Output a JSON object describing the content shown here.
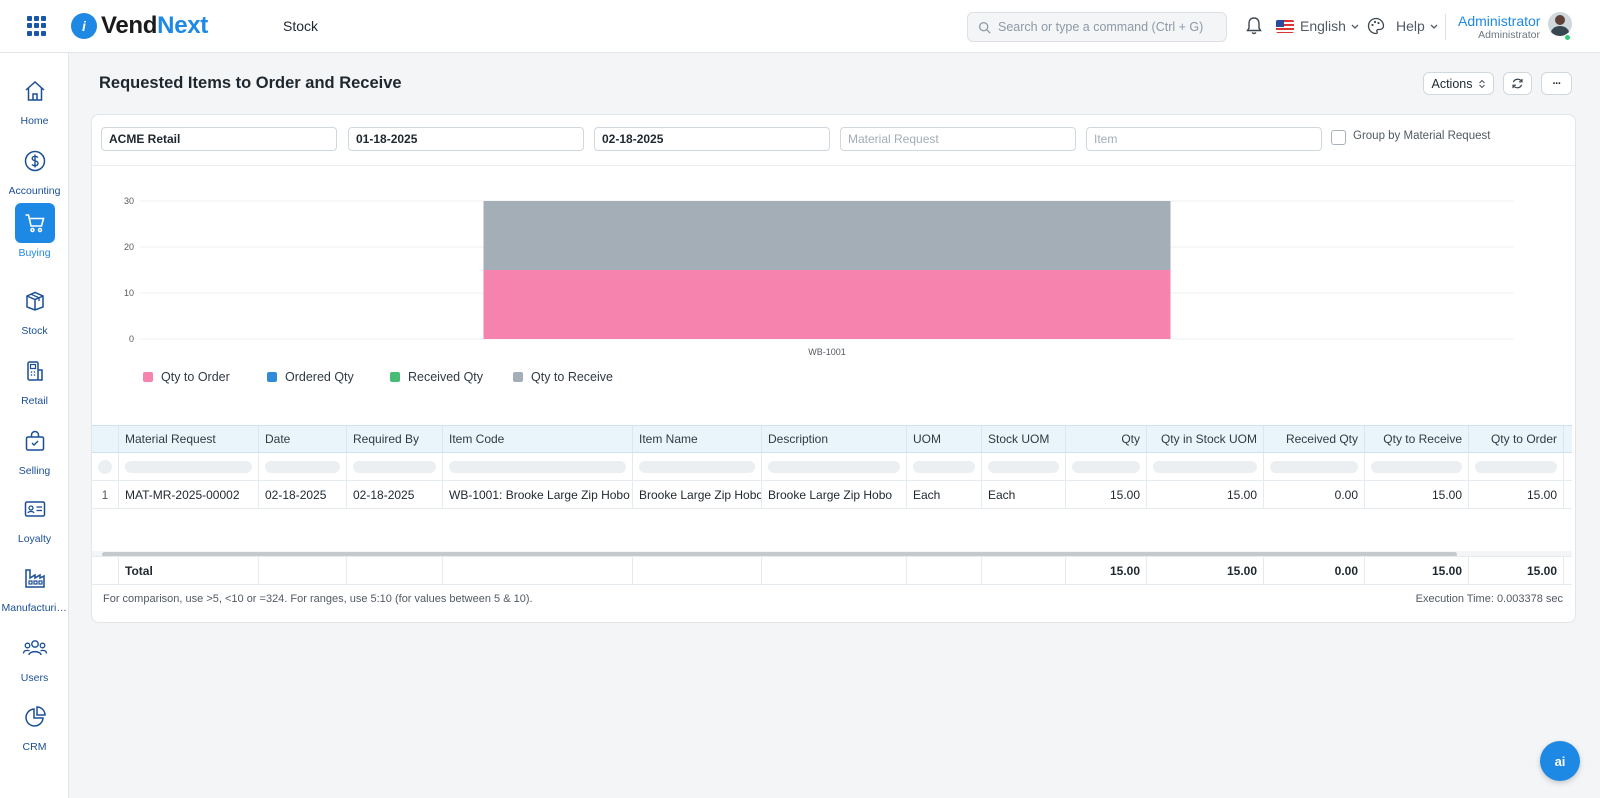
{
  "header": {
    "brand_i": "i",
    "brand_vend": "Vend",
    "brand_next": "Next",
    "module": "Stock",
    "search_placeholder": "Search or type a command (Ctrl + G)",
    "language": "English",
    "help": "Help",
    "user_name": "Administrator",
    "user_role": "Administrator"
  },
  "sidebar": {
    "items": [
      {
        "label": "Home",
        "icon": "home-icon"
      },
      {
        "label": "Accounting",
        "icon": "dollar-icon"
      },
      {
        "label": "Buying",
        "icon": "cart-icon"
      },
      {
        "label": "Stock",
        "icon": "box-icon"
      },
      {
        "label": "Retail",
        "icon": "pos-icon"
      },
      {
        "label": "Selling",
        "icon": "bag-icon"
      },
      {
        "label": "Loyalty",
        "icon": "card-icon"
      },
      {
        "label": "Manufacturing",
        "icon": "factory-icon"
      },
      {
        "label": "Users",
        "icon": "users-icon"
      },
      {
        "label": "CRM",
        "icon": "pie-icon"
      }
    ],
    "active": "Buying"
  },
  "page": {
    "title": "Requested Items to Order and Receive",
    "actions_label": "Actions",
    "more_label": "···"
  },
  "filters": {
    "company": "ACME Retail",
    "from_date": "01-18-2025",
    "to_date": "02-18-2025",
    "material_request_placeholder": "Material Request",
    "item_placeholder": "Item",
    "group_by_label": "Group by Material Request"
  },
  "chart_data": {
    "type": "bar",
    "stacked": true,
    "categories": [
      "WB-1001"
    ],
    "series": [
      {
        "name": "Qty to Order",
        "values": [
          15
        ],
        "color": "#f683ae"
      },
      {
        "name": "Ordered Qty",
        "values": [
          0
        ],
        "color": "#318ad8"
      },
      {
        "name": "Received Qty",
        "values": [
          0
        ],
        "color": "#48bb74"
      },
      {
        "name": "Qty to Receive",
        "values": [
          15
        ],
        "color": "#a4aeb7"
      }
    ],
    "yticks": [
      0,
      10,
      20,
      30
    ],
    "ylim": [
      0,
      30
    ],
    "legend": "bottom-left"
  },
  "table": {
    "columns": [
      "Material Request",
      "Date",
      "Required By",
      "Item Code",
      "Item Name",
      "Description",
      "UOM",
      "Stock UOM",
      "Qty",
      "Qty in Stock UOM",
      "Received Qty",
      "Qty to Receive",
      "Qty to Order"
    ],
    "rows": [
      {
        "index": "1",
        "material_request": "MAT-MR-2025-00002",
        "date": "02-18-2025",
        "required_by": "02-18-2025",
        "item_code": "WB-1001: Brooke Large Zip Hobo",
        "item_name": "Brooke Large Zip Hobo",
        "description": "Brooke Large Zip Hobo",
        "uom": "Each",
        "stock_uom": "Each",
        "qty": "15.00",
        "qty_stock_uom": "15.00",
        "received_qty": "0.00",
        "qty_to_receive": "15.00",
        "qty_to_order": "15.00"
      }
    ],
    "total": {
      "label": "Total",
      "qty": "15.00",
      "qty_stock_uom": "15.00",
      "received_qty": "0.00",
      "qty_to_receive": "15.00",
      "qty_to_order": "15.00"
    }
  },
  "footer": {
    "hint": "For comparison, use >5, <10 or =324. For ranges, use 5:10 (for values between 5 & 10).",
    "execution_time": "Execution Time: 0.003378 sec"
  },
  "ai_button_label": "ai"
}
